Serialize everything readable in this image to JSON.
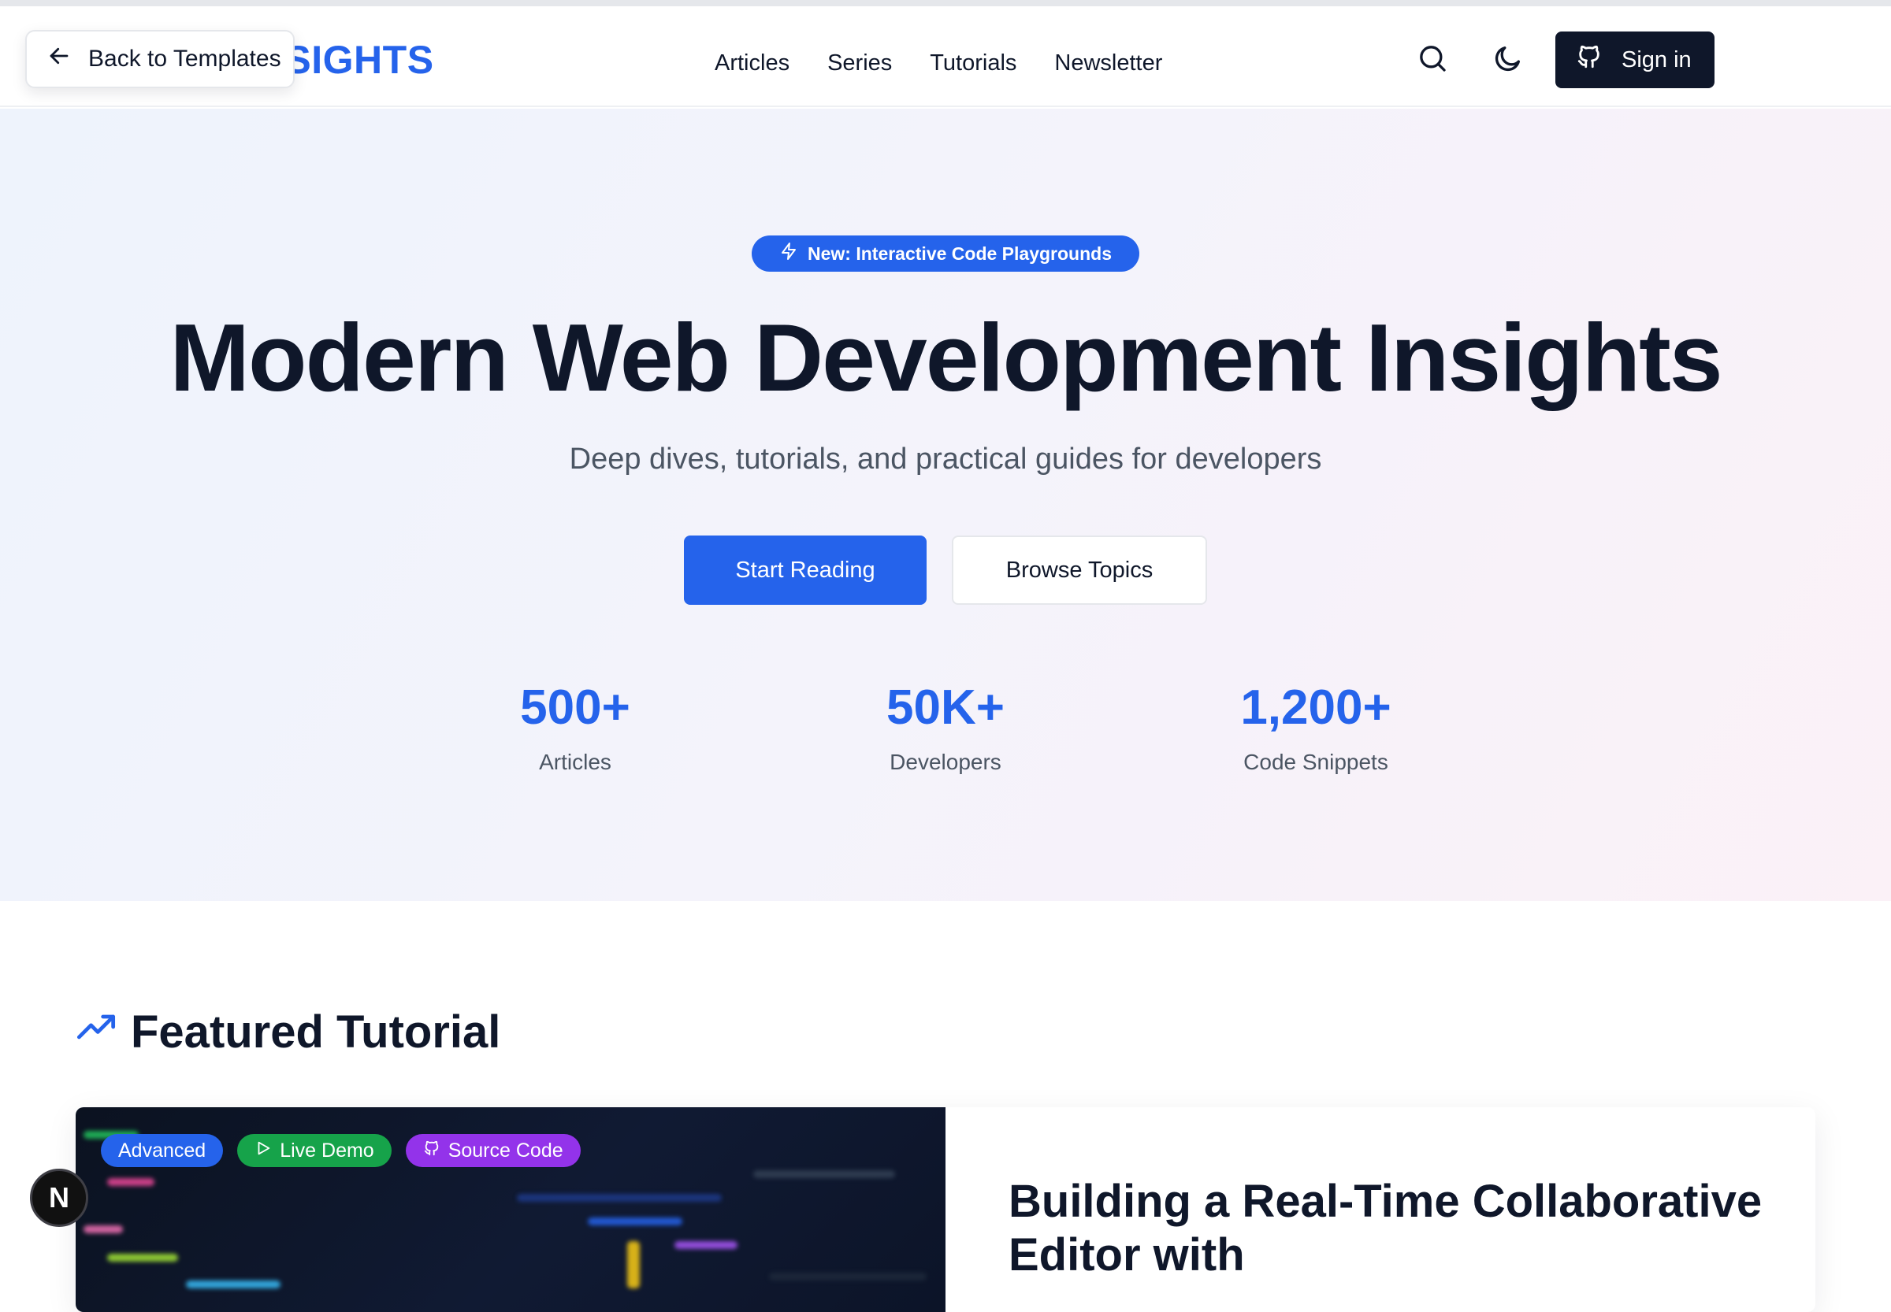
{
  "header": {
    "back_label": "Back to Templates",
    "logo_slash": "/",
    "logo_text": "INSIGHTS",
    "nav": [
      "Articles",
      "Series",
      "Tutorials",
      "Newsletter"
    ],
    "signin_label": "Sign in"
  },
  "hero": {
    "badge": "New: Interactive Code Playgrounds",
    "title": "Modern Web Development Insights",
    "subtitle": "Deep dives, tutorials, and practical guides for developers",
    "primary_cta": "Start Reading",
    "secondary_cta": "Browse Topics",
    "stats": [
      {
        "value": "500+",
        "label": "Articles"
      },
      {
        "value": "50K+",
        "label": "Developers"
      },
      {
        "value": "1,200+",
        "label": "Code Snippets"
      }
    ]
  },
  "featured": {
    "heading": "Featured Tutorial",
    "tags": [
      "Advanced",
      "Live Demo",
      "Source Code"
    ],
    "title": "Building a Real-Time Collaborative Editor with"
  },
  "floating": {
    "next_badge": "N"
  },
  "colors": {
    "accent": "#2563eb",
    "dark": "#0f172a",
    "tag_advanced": "#2563eb",
    "tag_live_demo": "#16a34a",
    "tag_source_code": "#9333ea"
  },
  "icons": [
    "arrow-left-icon",
    "search-icon",
    "moon-icon",
    "github-icon",
    "zap-icon",
    "trending-up-icon",
    "play-icon"
  ]
}
